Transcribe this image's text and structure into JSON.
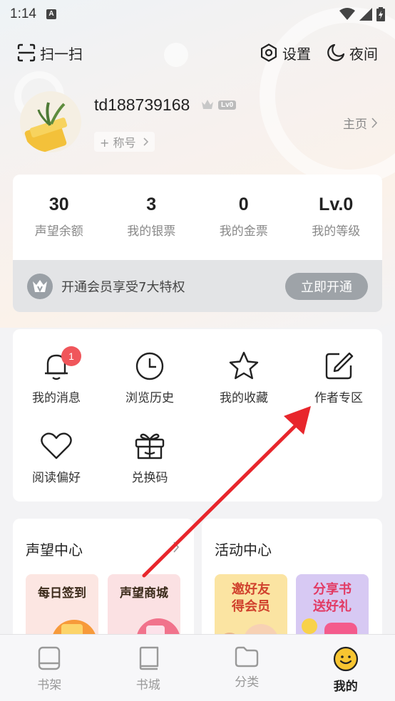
{
  "status_bar": {
    "time": "1:14",
    "notification_icon": "A"
  },
  "top_bar": {
    "scan_label": "扫一扫",
    "settings_label": "设置",
    "night_label": "夜间"
  },
  "profile": {
    "username": "td188739168",
    "level_badge": "Lv0",
    "title_chip": "+ 称号",
    "homepage_link": "主页"
  },
  "stats": [
    {
      "value": "30",
      "label": "声望余额"
    },
    {
      "value": "3",
      "label": "我的银票"
    },
    {
      "value": "0",
      "label": "我的金票"
    },
    {
      "value": "Lv.0",
      "label": "我的等级"
    }
  ],
  "vip": {
    "text": "开通会员享受7大特权",
    "button": "立即开通"
  },
  "menu": [
    {
      "label": "我的消息",
      "icon": "bell-icon",
      "badge": "1"
    },
    {
      "label": "浏览历史",
      "icon": "clock-icon"
    },
    {
      "label": "我的收藏",
      "icon": "star-icon"
    },
    {
      "label": "作者专区",
      "icon": "edit-icon"
    },
    {
      "label": "阅读偏好",
      "icon": "heart-icon"
    },
    {
      "label": "兑换码",
      "icon": "gift-icon"
    }
  ],
  "centers": {
    "reputation": {
      "title": "声望中心",
      "promo1": "每日签到",
      "promo2": "声望商城"
    },
    "activity": {
      "title": "活动中心",
      "promo1_line1": "邀好友",
      "promo1_line2": "得会员",
      "promo2_line1": "分享书",
      "promo2_line2": "送好礼"
    }
  },
  "bottom_nav": [
    {
      "label": "书架",
      "icon": "bookshelf-icon"
    },
    {
      "label": "书城",
      "icon": "book-icon"
    },
    {
      "label": "分类",
      "icon": "folder-icon"
    },
    {
      "label": "我的",
      "icon": "smiley-icon",
      "active": true
    }
  ],
  "colors": {
    "accent_red": "#e8262c",
    "badge_red": "#f0565b",
    "active_yellow": "#f7c531"
  }
}
